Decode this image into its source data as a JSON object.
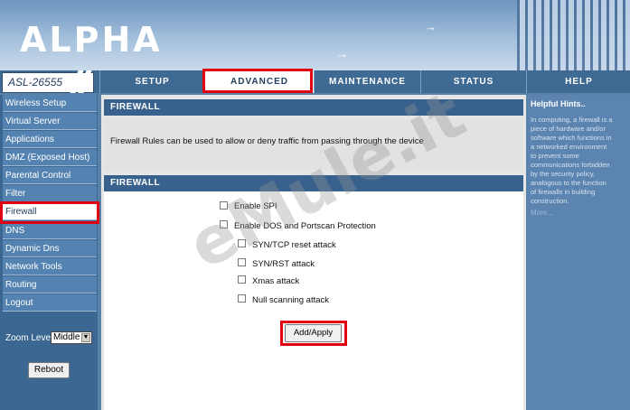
{
  "brand": {
    "logo": "ALPHA",
    "model": "ASL-26555"
  },
  "tabs": [
    "SETUP",
    "ADVANCED",
    "MAINTENANCE",
    "STATUS",
    "HELP"
  ],
  "sidebar": {
    "items": [
      "Wireless Setup",
      "Virtual Server",
      "Applications",
      "DMZ (Exposed Host)",
      "Parental Control",
      "Filter",
      "Firewall",
      "DNS",
      "Dynamic Dns",
      "Network Tools",
      "Routing",
      "Logout"
    ],
    "active": "Firewall"
  },
  "zoom": {
    "label": "Zoom Level:",
    "value": "Middle"
  },
  "reboot_label": "Reboot",
  "main": {
    "section1_title": "FIREWALL",
    "description": "Firewall Rules can be used to allow or deny traffic from passing through the device",
    "section2_title": "FIREWALL",
    "options": [
      {
        "label": "Enable SPI",
        "checked": false
      },
      {
        "label": "Enable DOS and Portscan Protection",
        "checked": false
      },
      {
        "label": "SYN/TCP reset attack",
        "checked": false
      },
      {
        "label": "SYN/RST attack",
        "checked": false
      },
      {
        "label": "Xmas attack",
        "checked": false
      },
      {
        "label": "Null scanning attack",
        "checked": false
      }
    ],
    "apply_label": "Add/Apply"
  },
  "help": {
    "title": "Helpful Hints..",
    "text": "In computing, a firewall is a piece of hardware and/or software which functions in a networked environment to prevent some communications forbidden by the security policy, analogous to the function of firewalls in building construction.",
    "more": "More..."
  },
  "watermark": "eMule.it",
  "colors": {
    "highlight": "#e00010",
    "nav": "#3e6a94",
    "section_bar": "#38628d"
  }
}
